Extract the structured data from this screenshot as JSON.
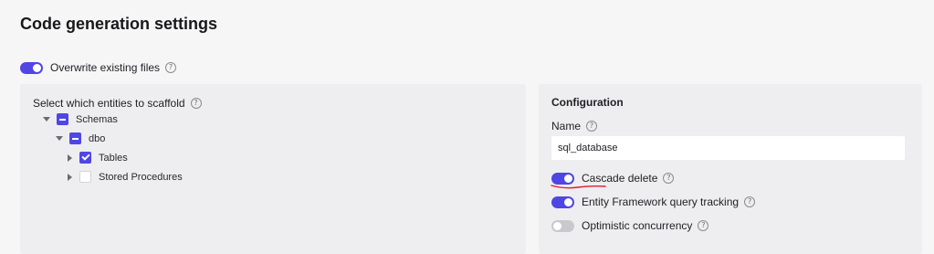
{
  "page": {
    "title": "Code generation settings"
  },
  "overwrite": {
    "label": "Overwrite existing files",
    "enabled": true,
    "help_icon": "question-circle-icon"
  },
  "entities": {
    "heading": "Select which entities to scaffold",
    "help_icon": "question-circle-icon",
    "tree": {
      "schemas": {
        "label": "Schemas",
        "expanded": true,
        "state": "indeterminate"
      },
      "dbo": {
        "label": "dbo",
        "expanded": true,
        "state": "indeterminate"
      },
      "tables": {
        "label": "Tables",
        "expanded": false,
        "state": "checked"
      },
      "stored_procedures": {
        "label": "Stored Procedures",
        "expanded": false,
        "state": "unchecked"
      }
    }
  },
  "configuration": {
    "heading": "Configuration",
    "name_label": "Name",
    "name_value": "sql_database",
    "options": {
      "cascade_delete": {
        "label": "Cascade delete",
        "enabled": true
      },
      "ef_tracking": {
        "label": "Entity Framework query tracking",
        "enabled": true
      },
      "optimistic_concurrency": {
        "label": "Optimistic concurrency",
        "enabled": false
      }
    }
  },
  "colors": {
    "accent": "#4f46e5",
    "toggle_off": "#c9c9cd",
    "annotation": "#e11d2a"
  },
  "help_glyph": "?"
}
